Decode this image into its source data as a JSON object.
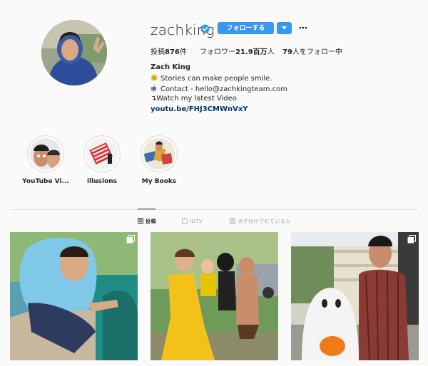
{
  "profile": {
    "username": "zachking",
    "follow_label": "フォローする",
    "stats": {
      "posts_label": "投稿",
      "posts_count": "876",
      "posts_suffix": "件",
      "followers_label": "フォロワー",
      "followers_count": "21.9百万",
      "followers_suffix": "人",
      "following_count": "79",
      "following_suffix": "人をフォロー中"
    },
    "full_name": "Zach King",
    "bio": [
      "Stories can make people smile.",
      "Contact - hello@zachkingteam.com",
      "↴Watch my latest Video"
    ],
    "link": "youtu.be/FHJ3CMWnVxY"
  },
  "highlights": [
    {
      "label": "YouTube Vi..."
    },
    {
      "label": "illusions"
    },
    {
      "label": "My Books"
    }
  ],
  "tabs": [
    {
      "label": "投稿",
      "icon": "grid-icon",
      "active": true
    },
    {
      "label": "IGTV",
      "icon": "igtv-icon",
      "active": false
    },
    {
      "label": "タグ付けされている人",
      "icon": "tagged-icon",
      "active": false
    }
  ],
  "colors": {
    "accent": "#3897f0",
    "link": "#003569",
    "background": "#fafafa",
    "border": "#dbdbdb"
  }
}
